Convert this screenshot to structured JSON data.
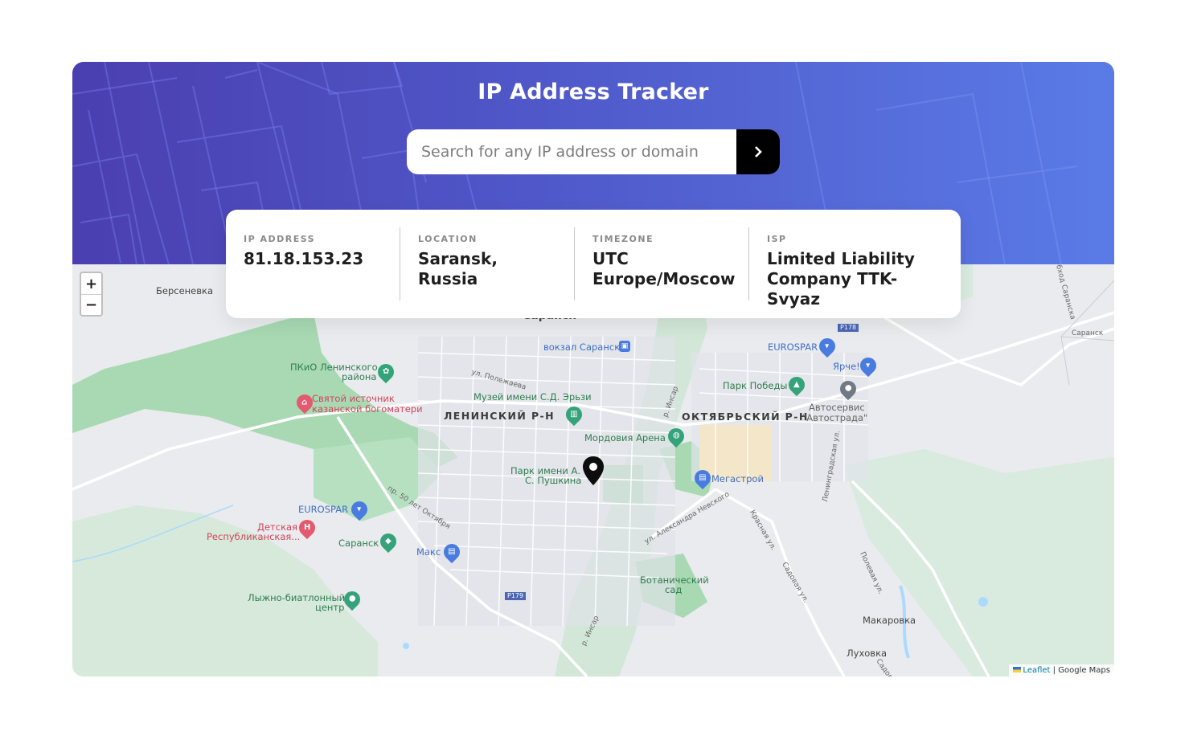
{
  "header": {
    "title": "IP Address Tracker",
    "search_placeholder": "Search for any IP address or domain",
    "search_value": "",
    "submit_icon": "chevron-right-icon"
  },
  "info": {
    "ip": {
      "label": "IP ADDRESS",
      "value": "81.18.153.23"
    },
    "location": {
      "label": "LOCATION",
      "value": "Saransk, Russia"
    },
    "timezone": {
      "label": "TIMEZONE",
      "value": "UTC Europe/Moscow"
    },
    "isp": {
      "label": "ISP",
      "value": "Limited Liability Company TTK-Svyaz"
    }
  },
  "map": {
    "zoom_in": "+",
    "zoom_out": "−",
    "labels": {
      "berseneva": "Берсеневка",
      "saransk_top": "Саранск",
      "vokzal": "вокзал Саранск",
      "pkio_1": "ПКиО Ленинского",
      "pkio_2": "района",
      "ul_polezhaeva": "ул. Полежаева",
      "museum": "Музей имени С.Д. Эрьзи",
      "svyatoy_1": "Святой источник",
      "svyatoy_2": "казанской богоматери",
      "leninsky": "ЛЕНИНСКИЙ Р-Н",
      "oktyabrsky": "ОКТЯБРЬСКИЙ Р-Н",
      "eurospar_top": "EUROSPAR",
      "yarche": "Ярче!",
      "park_pobedy": "Парк Победы",
      "avtoservis_1": "Автосервис",
      "avtoservis_2": "\"Автострада\"",
      "mordovia": "Мордовия Арена",
      "park_pushkina_1": "Парк имени А.",
      "park_pushkina_2": "С. Пушкина",
      "megastroy": "Мегастрой",
      "eurospar_left": "EUROSPAR",
      "detskaya_1": "Детская",
      "detskaya_2": "Республиканская...",
      "saransk_station": "Саранск",
      "maks": "Макс",
      "botanical_1": "Ботанический",
      "botanical_2": "сад",
      "lyzhno_1": "Лыжно-биатлонный",
      "lyzhno_2": "центр",
      "makarovka": "Макаровка",
      "lukhovka": "Луховка",
      "p178": "Р178",
      "p179": "Р179",
      "saransk_road": "Саранск",
      "pr_50": "пр. 50 лет Октября",
      "ul_alexandrovskogo": "ул. Александра Невского",
      "insar_1": "р. Инсар",
      "insar_2": "р. Инсар",
      "leningradskaya": "Ленинградская ул.",
      "krasnaya": "Красная ул.",
      "sadovaya": "Садовая ул.",
      "polevaya": "Полевая ул.",
      "road_saransk": "Обход Саранска",
      "sadov": "Садов"
    },
    "attribution_leaflet": "Leaflet",
    "attribution_sep": "|",
    "attribution_google": "Google Maps"
  },
  "colors": {
    "gradient_start": "#4b3fb0",
    "gradient_end": "#5a7be6",
    "park_green": "#a8dab5",
    "water": "#aadaff",
    "button_black": "#000000"
  }
}
